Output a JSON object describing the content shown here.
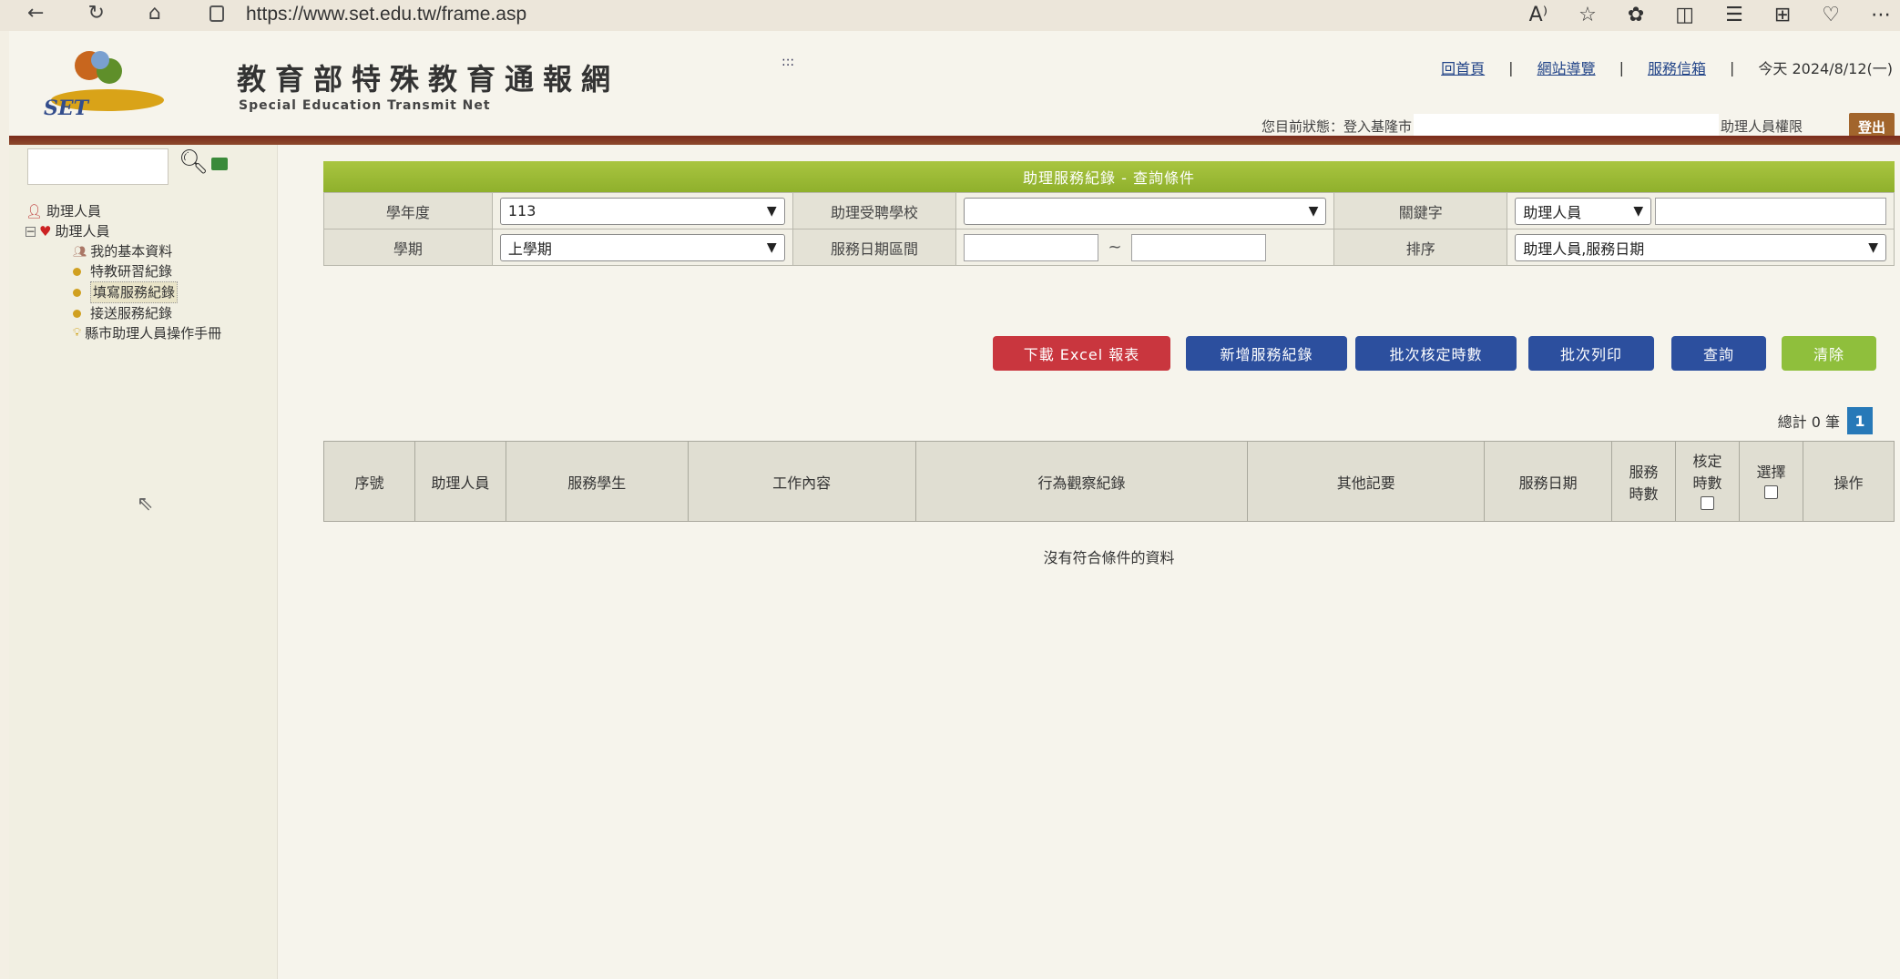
{
  "browser": {
    "url": "https://www.set.edu.tw/frame.asp",
    "nav": {
      "back": "←",
      "refresh": "↻",
      "home": "⌂"
    },
    "icons": [
      "read-aloud-icon",
      "favorite-icon",
      "extensions-icon",
      "split-screen-icon",
      "favorites-icon",
      "collections-icon",
      "performance-icon",
      "more-icon"
    ]
  },
  "header": {
    "title": "教育部特殊教育通報網",
    "subtitle": "Special Education Transmit Net",
    "logo_text": "SET",
    "dots": ":::",
    "links": {
      "home": "回首頁",
      "sitemap": "網站導覽",
      "mailbox": "服務信箱"
    },
    "separator": "|",
    "date": "今天 2024/8/12(一)",
    "status_prefix": "您目前狀態：登入基隆市",
    "status_suffix": "助理人員權限",
    "logout": "登出",
    "colors": {
      "rule": "#7a2c1c",
      "logout": "#a2652c"
    }
  },
  "sidebar": {
    "root_label": "助理人員",
    "group_label": "助理人員",
    "items": [
      {
        "label": "我的基本資料"
      },
      {
        "label": "特教研習紀錄"
      },
      {
        "label": "填寫服務紀錄"
      },
      {
        "label": "接送服務紀錄"
      },
      {
        "label": "縣市助理人員操作手冊"
      }
    ]
  },
  "panel": {
    "title": "助理服務紀錄 - 查詢條件",
    "labels": {
      "year": "學年度",
      "semester": "學期",
      "school": "助理受聘學校",
      "date_range": "服務日期區間",
      "keyword": "關鍵字",
      "sort": "排序"
    },
    "values": {
      "year": "113",
      "semester": "上學期",
      "school": "",
      "keyword_field": "助理人員",
      "keyword_text": "",
      "sort": "助理人員,服務日期",
      "date_from": "",
      "date_to": ""
    },
    "tilde": "~"
  },
  "actions": {
    "download": "下載 Excel 報表",
    "add": "新增服務紀錄",
    "batch_approve": "批次核定時數",
    "batch_print": "批次列印",
    "search": "查詢",
    "clear": "清除",
    "colors": {
      "red": "#c9363e",
      "blue": "#2c4f9e",
      "green": "#8fbf3c"
    }
  },
  "results": {
    "total_label": "總計 0 筆",
    "page": "1",
    "columns": {
      "no": "序號",
      "assistant": "助理人員",
      "student": "服務學生",
      "work": "工作內容",
      "behavior": "行為觀察紀錄",
      "other": "其他記要",
      "date": "服務日期",
      "hours_a": "服務",
      "hours_b": "時數",
      "approved_a": "核定",
      "approved_b": "時數",
      "select": "選擇",
      "action": "操作"
    },
    "empty": "沒有符合條件的資料"
  }
}
